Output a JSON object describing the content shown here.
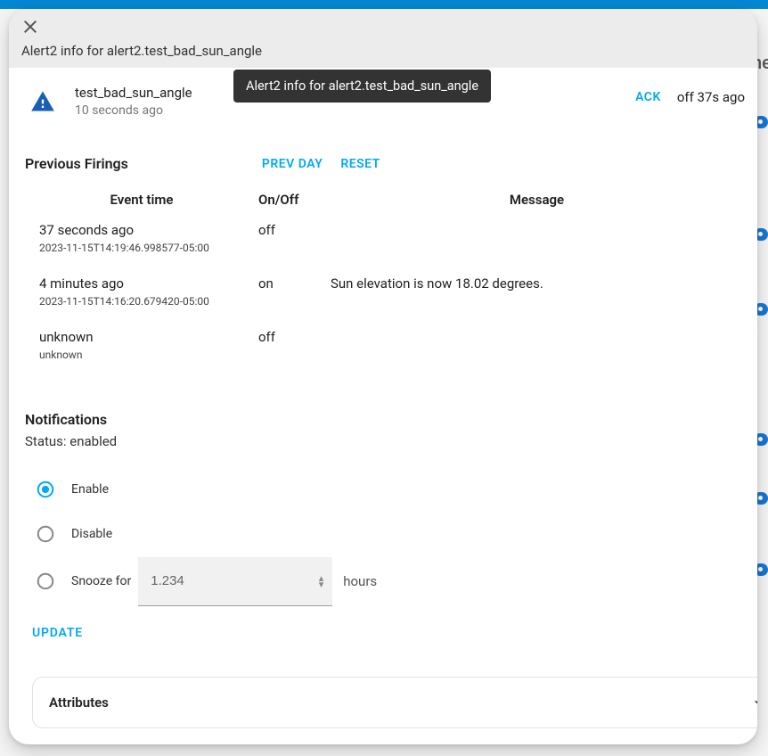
{
  "header": {
    "title": "Alert2 info for alert2.test_bad_sun_angle"
  },
  "tooltip": "Alert2 info for alert2.test_bad_sun_angle",
  "summary": {
    "name": "test_bad_sun_angle",
    "elapsed": "10 seconds ago",
    "ack_label": "ACK",
    "state_text": "off  37s ago"
  },
  "firings": {
    "title": "Previous Firings",
    "prev_label": "PREV DAY",
    "reset_label": "RESET",
    "columns": {
      "time": "Event time",
      "onoff": "On/Off",
      "message": "Message"
    },
    "rows": [
      {
        "rel": "37 seconds ago",
        "ts": "2023-11-15T14:19:46.998577-05:00",
        "onoff": "off",
        "message": ""
      },
      {
        "rel": "4 minutes ago",
        "ts": "2023-11-15T14:16:20.679420-05:00",
        "onoff": "on",
        "message": "Sun elevation is now 18.02 degrees."
      },
      {
        "rel": "unknown",
        "ts": "unknown",
        "onoff": "off",
        "message": ""
      }
    ]
  },
  "notifications": {
    "title": "Notifications",
    "status_line": "Status: enabled",
    "options": {
      "enable": "Enable",
      "disable": "Disable",
      "snooze": "Snooze for"
    },
    "snooze_value": "1.234",
    "snooze_unit": "hours",
    "update_label": "UPDATE",
    "selected": "enable"
  },
  "attributes": {
    "label": "Attributes"
  }
}
